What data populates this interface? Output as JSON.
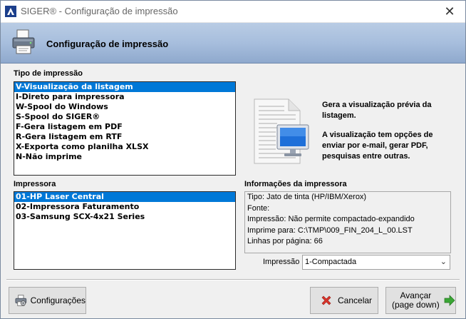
{
  "window": {
    "title": "SIGER® - Configuração de impressão",
    "close_glyph": "✕"
  },
  "header": {
    "title": "Configuração de impressão",
    "icon": "printer-icon"
  },
  "print_type": {
    "label": "Tipo de impressão",
    "items": [
      "V-Visualização da listagem",
      "I-Direto para impressora",
      "W-Spool do Windows",
      "S-Spool do SIGER®",
      "F-Gera listagem em PDF",
      "R-Gera listagem em RTF",
      "X-Exporta como planilha XLSX",
      "N-Não imprime"
    ],
    "selected_index": 0
  },
  "description": {
    "line1": "Gera a visualização prévia da",
    "line2": "listagem.",
    "line3": "A visualização tem opções de",
    "line4": "enviar por e-mail, gerar PDF,",
    "line5": "pesquisas entre outras."
  },
  "printer": {
    "label": "Impressora",
    "items": [
      "01-HP Laser Central",
      "02-Impressora Faturamento",
      "03-Samsung SCX-4x21 Series"
    ],
    "selected_index": 0
  },
  "printer_info": {
    "label": "Informações da impressora",
    "lines": [
      "Tipo: Jato de tinta (HP/IBM/Xerox)",
      "Fonte:",
      "Impressão: Não permite compactado-expandido",
      "Imprime para: C:\\TMP\\009_FIN_204_L_00.LST",
      "Linhas por página: 66"
    ]
  },
  "impressao": {
    "label": "Impressão",
    "value": "1-Compactada"
  },
  "buttons": {
    "config": "Configurações",
    "cancel": "Cancelar",
    "next_line1": "Avançar",
    "next_line2": "(page down)"
  },
  "colors": {
    "selection": "#0078d7",
    "header_gradient_top": "#b9cce4",
    "header_gradient_bottom": "#8fa9cd",
    "cancel_icon": "#d9342b",
    "next_icon": "#3aa635"
  }
}
